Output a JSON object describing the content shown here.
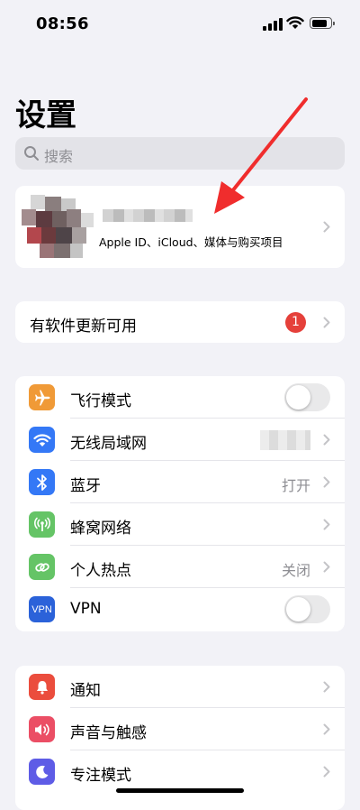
{
  "status_bar": {
    "time": "08:56"
  },
  "title": "设置",
  "search": {
    "placeholder": "搜索"
  },
  "account": {
    "subtitle": "Apple ID、iCloud、媒体与购买项目"
  },
  "update": {
    "label": "有软件更新可用",
    "badge": "1"
  },
  "connectivity": [
    {
      "label": "飞行模式",
      "value": "",
      "icon": "airplane-icon",
      "color": "#f09a37"
    },
    {
      "label": "无线局域网",
      "value": "",
      "icon": "wifi-icon",
      "color": "#3478f6"
    },
    {
      "label": "蓝牙",
      "value": "打开",
      "icon": "bluetooth-icon",
      "color": "#3478f6"
    },
    {
      "label": "蜂窝网络",
      "value": "",
      "icon": "cellular-icon",
      "color": "#65c466"
    },
    {
      "label": "个人热点",
      "value": "关闭",
      "icon": "hotspot-icon",
      "color": "#65c466"
    },
    {
      "label": "VPN",
      "value": "",
      "icon": "vpn-icon",
      "icon_text": "VPN",
      "color": "#2b62d9"
    }
  ],
  "notifications": [
    {
      "label": "通知",
      "icon": "notifications-icon",
      "color": "#eb4d3d"
    },
    {
      "label": "声音与触感",
      "icon": "sound-icon",
      "color": "#eb4e65"
    },
    {
      "label": "专注模式",
      "icon": "focus-moon-icon",
      "color": "#5e5ce6"
    }
  ],
  "accent_colors": {
    "annotation_arrow": "#f02d2d",
    "badge": "#e5403a"
  }
}
